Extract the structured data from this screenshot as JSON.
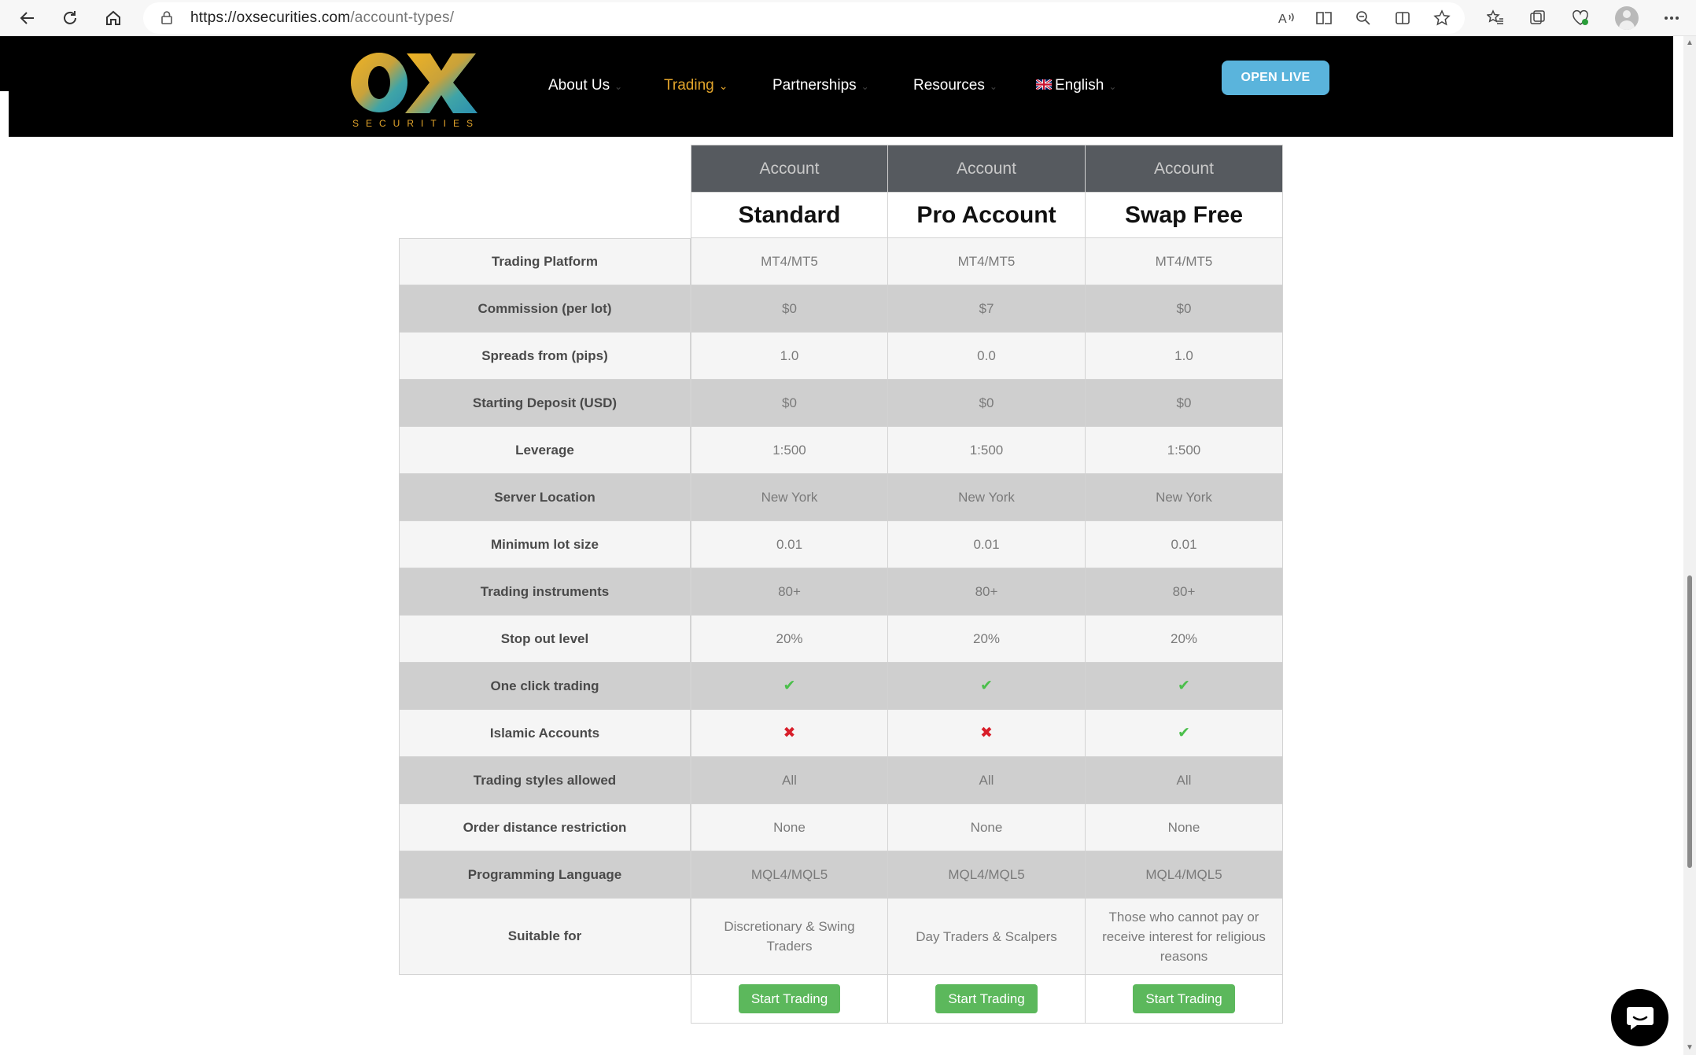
{
  "browser": {
    "url_host": "https://oxsecurities.com",
    "url_path": "/account-types/"
  },
  "header": {
    "logo_text": "OX",
    "logo_sub": "SECURITIES",
    "nav": [
      "About Us",
      "Trading",
      "Partnerships",
      "Resources",
      "English"
    ],
    "open_live": "OPEN LIVE"
  },
  "table": {
    "head_label": "Account",
    "accounts": [
      "Standard",
      "Pro Account",
      "Swap Free"
    ],
    "rows": [
      {
        "label": "Trading Platform",
        "values": [
          "MT4/MT5",
          "MT4/MT5",
          "MT4/MT5"
        ]
      },
      {
        "label": "Commission (per lot)",
        "values": [
          "$0",
          "$7",
          "$0"
        ]
      },
      {
        "label": "Spreads from (pips)",
        "values": [
          "1.0",
          "0.0",
          "1.0"
        ]
      },
      {
        "label": "Starting Deposit (USD)",
        "values": [
          "$0",
          "$0",
          "$0"
        ]
      },
      {
        "label": "Leverage",
        "values": [
          "1:500",
          "1:500",
          "1:500"
        ]
      },
      {
        "label": "Server Location",
        "values": [
          "New York",
          "New York",
          "New York"
        ]
      },
      {
        "label": "Minimum lot size",
        "values": [
          "0.01",
          "0.01",
          "0.01"
        ]
      },
      {
        "label": "Trading instruments",
        "values": [
          "80+",
          "80+",
          "80+"
        ]
      },
      {
        "label": "Stop out level",
        "values": [
          "20%",
          "20%",
          "20%"
        ]
      },
      {
        "label": "One click trading",
        "values": [
          "check",
          "check",
          "check"
        ]
      },
      {
        "label": "Islamic Accounts",
        "values": [
          "cross",
          "cross",
          "check"
        ]
      },
      {
        "label": "Trading styles allowed",
        "values": [
          "All",
          "All",
          "All"
        ]
      },
      {
        "label": "Order distance restriction",
        "values": [
          "None",
          "None",
          "None"
        ]
      },
      {
        "label": "Programming Language",
        "values": [
          "MQL4/MQL5",
          "MQL4/MQL5",
          "MQL4/MQL5"
        ]
      },
      {
        "label": "Suitable for",
        "values": [
          "Discretionary & Swing Traders",
          "Day Traders & Scalpers",
          "Those who cannot pay or receive interest for religious reasons"
        ]
      }
    ],
    "cta": "Start Trading"
  },
  "colors": {
    "header_bg": "#000000",
    "accent_gold": "#e3a52b",
    "open_live": "#5ab4dc",
    "cta_green": "#5cb85c",
    "check_green": "#4bbf4b",
    "cross_red": "#d81e2a"
  }
}
